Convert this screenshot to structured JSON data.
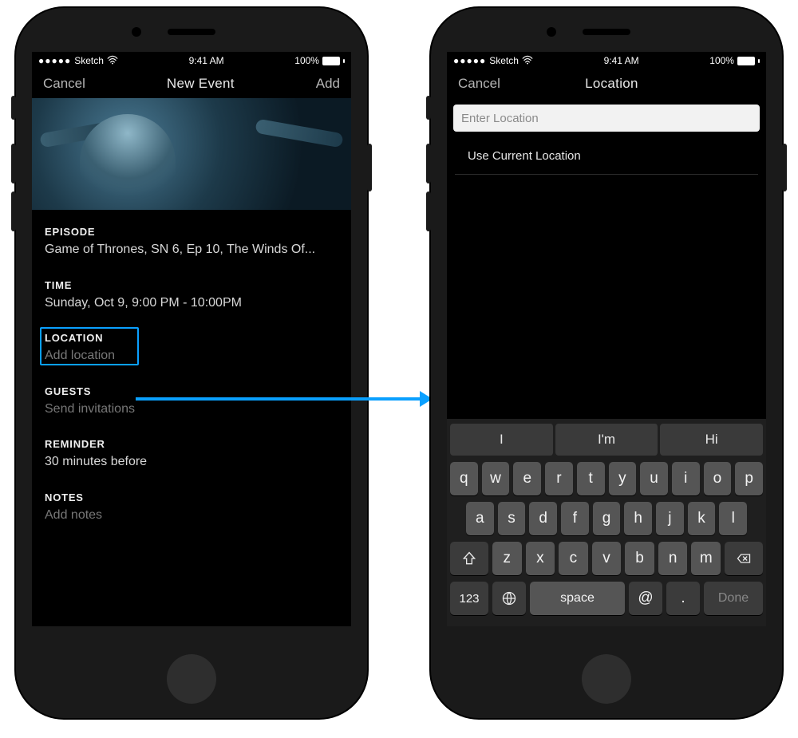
{
  "status": {
    "carrier": "Sketch",
    "time": "9:41 AM",
    "battery_pct": "100%"
  },
  "left": {
    "nav": {
      "cancel": "Cancel",
      "title": "New Event",
      "add": "Add"
    },
    "sections": {
      "episode_label": "EPISODE",
      "episode_value": "Game of Thrones, SN 6, Ep 10, The Winds Of...",
      "time_label": "TIME",
      "time_value": "Sunday, Oct 9, 9:00 PM - 10:00PM",
      "location_label": "LOCATION",
      "location_placeholder": "Add location",
      "guests_label": "GUESTS",
      "guests_placeholder": "Send invitations",
      "reminder_label": "REMINDER",
      "reminder_value": "30 minutes before",
      "notes_label": "NOTES",
      "notes_placeholder": "Add notes"
    }
  },
  "right": {
    "nav": {
      "cancel": "Cancel",
      "title": "Location"
    },
    "input_placeholder": "Enter Location",
    "use_current": "Use Current Location",
    "keyboard": {
      "suggestions": [
        "I",
        "I'm",
        "Hi"
      ],
      "row1": [
        "q",
        "w",
        "e",
        "r",
        "t",
        "y",
        "u",
        "i",
        "o",
        "p"
      ],
      "row2": [
        "a",
        "s",
        "d",
        "f",
        "g",
        "h",
        "j",
        "k",
        "l"
      ],
      "row3": [
        "z",
        "x",
        "c",
        "v",
        "b",
        "n",
        "m"
      ],
      "numkey": "123",
      "space": "space",
      "at": "@",
      "dot": ".",
      "done": "Done"
    }
  }
}
